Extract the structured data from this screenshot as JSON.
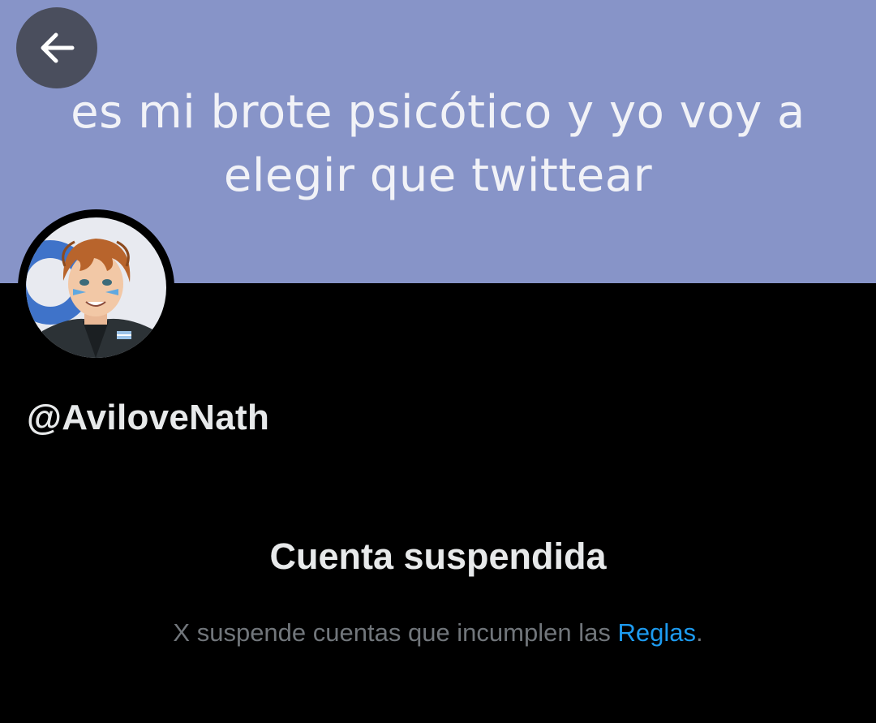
{
  "header": {
    "back_icon": "arrow-left-icon",
    "banner_lines": [
      "es mi brote psicótico y yo voy a",
      "elegir que twittear"
    ]
  },
  "profile": {
    "handle": "@AviloveNath",
    "avatar": "anime-character-avatar"
  },
  "suspension": {
    "title": "Cuenta suspendida",
    "message_prefix": "X suspende cuentas que incumplen las ",
    "rules_link": "Reglas",
    "message_suffix": "."
  },
  "colors": {
    "banner_bg": "#8794c8",
    "page_bg": "#000000",
    "primary_text": "#e7e9ea",
    "secondary_text": "#71767b",
    "link": "#1d9bf0"
  }
}
